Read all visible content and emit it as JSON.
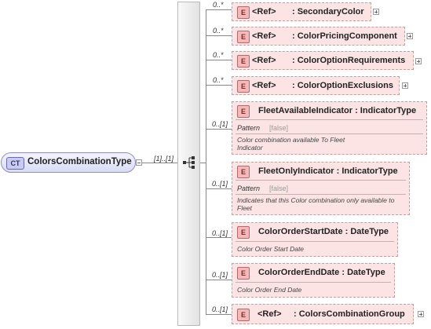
{
  "root": {
    "badge": "CT",
    "name": "ColorsCombinationType",
    "multiplicity": "[1]..[1]"
  },
  "elements": [
    {
      "badge": "E",
      "mult": "0..*",
      "label": "<Ref>",
      "name": ": SecondaryColor"
    },
    {
      "badge": "E",
      "mult": "0..*",
      "label": "<Ref>",
      "name": ": ColorPricingComponent"
    },
    {
      "badge": "E",
      "mult": "0..*",
      "label": "<Ref>",
      "name": ": ColorOptionRequirements"
    },
    {
      "badge": "E",
      "mult": "0..*",
      "label": "<Ref>",
      "name": ": ColorOptionExclusions"
    },
    {
      "badge": "E",
      "mult": "0..[1]",
      "name": "FleetAvailableIndicator : IndicatorType",
      "pattern": "Pattern",
      "pattern_value": "[false]",
      "doc": "Color combination available To Fleet Indicator"
    },
    {
      "badge": "E",
      "mult": "0..[1]",
      "name": "FleetOnlyIndicator : IndicatorType",
      "pattern": "Pattern",
      "pattern_value": "[false]",
      "doc": "Indicates that this Color combination only available to Fleet"
    },
    {
      "badge": "E",
      "mult": "0..[1]",
      "name": "ColorOrderStartDate : DateType",
      "doc": "Color Order Start Date"
    },
    {
      "badge": "E",
      "mult": "0..[1]",
      "name": "ColorOrderEndDate : DateType",
      "doc": "Color Order End Date"
    },
    {
      "badge": "E",
      "mult": "0..[1]",
      "label": "<Ref>",
      "name": ": ColorsCombinationGroup"
    }
  ],
  "colors": {
    "element_fill": "#fde4e4",
    "element_border": "#c3a0a0",
    "complex_type_fill": "#d9dbf5"
  }
}
